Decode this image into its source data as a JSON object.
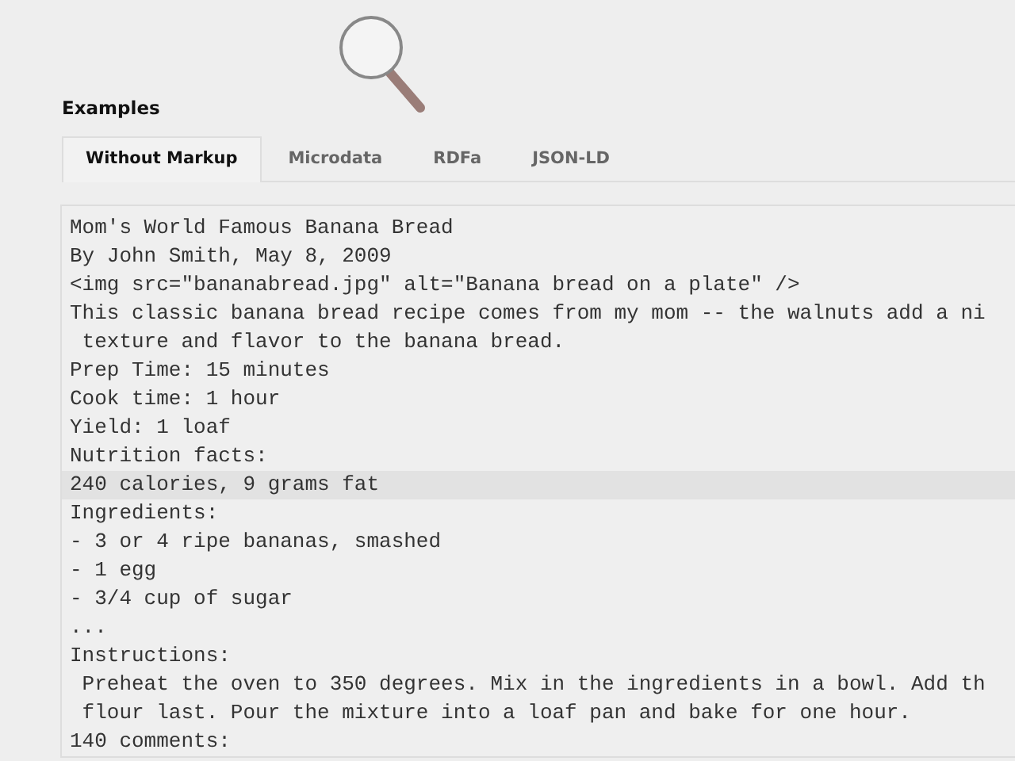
{
  "heading": "Examples",
  "tabs": [
    {
      "label": "Without Markup",
      "selected": true
    },
    {
      "label": "Microdata",
      "selected": false
    },
    {
      "label": "RDFa",
      "selected": false
    },
    {
      "label": "JSON-LD",
      "selected": false
    }
  ],
  "code_lines": [
    {
      "text": "Mom's World Famous Banana Bread",
      "highlighted": false
    },
    {
      "text": "By John Smith, May 8, 2009",
      "highlighted": false
    },
    {
      "text": "<img src=\"bananabread.jpg\" alt=\"Banana bread on a plate\" />",
      "highlighted": false
    },
    {
      "text": "This classic banana bread recipe comes from my mom -- the walnuts add a ni",
      "highlighted": false
    },
    {
      "text": " texture and flavor to the banana bread.",
      "highlighted": false
    },
    {
      "text": "Prep Time: 15 minutes",
      "highlighted": false
    },
    {
      "text": "Cook time: 1 hour",
      "highlighted": false
    },
    {
      "text": "Yield: 1 loaf",
      "highlighted": false
    },
    {
      "text": "Nutrition facts:",
      "highlighted": false
    },
    {
      "text": "240 calories, 9 grams fat",
      "highlighted": true
    },
    {
      "text": "Ingredients:",
      "highlighted": false
    },
    {
      "text": "- 3 or 4 ripe bananas, smashed",
      "highlighted": false
    },
    {
      "text": "- 1 egg",
      "highlighted": false
    },
    {
      "text": "- 3/4 cup of sugar",
      "highlighted": false
    },
    {
      "text": "...",
      "highlighted": false
    },
    {
      "text": "Instructions:",
      "highlighted": false
    },
    {
      "text": " Preheat the oven to 350 degrees. Mix in the ingredients in a bowl. Add th",
      "highlighted": false
    },
    {
      "text": " flour last. Pour the mixture into a loaf pan and bake for one hour.",
      "highlighted": false
    },
    {
      "text": "140 comments:",
      "highlighted": false
    }
  ]
}
